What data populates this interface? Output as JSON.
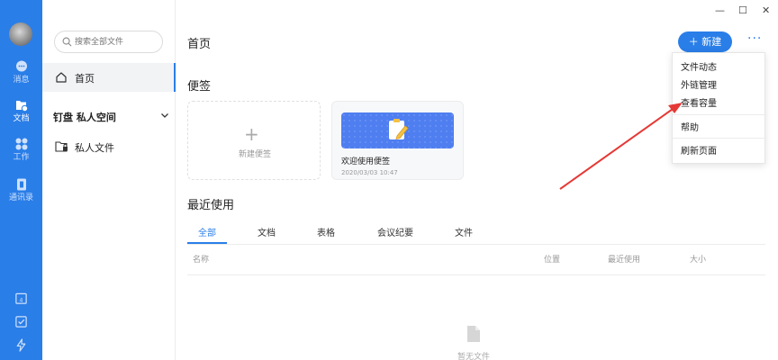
{
  "rail": {
    "items": [
      {
        "label": "消息",
        "icon": "chat-bubble-icon"
      },
      {
        "label": "文档",
        "icon": "cloud-folder-icon",
        "active": true
      },
      {
        "label": "工作",
        "icon": "grid-apps-icon"
      },
      {
        "label": "通讯录",
        "icon": "contacts-book-icon"
      }
    ],
    "bottom_icons": [
      "calendar-icon",
      "checkbox-icon",
      "lightning-icon"
    ]
  },
  "sidebar": {
    "search_placeholder": "搜索全部文件",
    "home_label": "首页",
    "space_label": "钉盘   私人空间",
    "private_label": "私人文件"
  },
  "window": {
    "minimize": "—",
    "maximize": "☐",
    "close": "✕"
  },
  "header": {
    "title": "首页",
    "new_label": "＋ 新建",
    "more_label": "···"
  },
  "notes": {
    "title": "便签",
    "new_label": "新建便签",
    "card": {
      "name": "欢迎使用便签",
      "date": "2020/03/03 10:47"
    }
  },
  "recent": {
    "title": "最近使用",
    "tabs": [
      "全部",
      "文档",
      "表格",
      "会议纪要",
      "文件"
    ],
    "columns": [
      "名称",
      "位置",
      "最近使用",
      "大小"
    ],
    "empty_text": "暂无文件"
  },
  "menu": {
    "items": [
      "文件动态",
      "外链管理",
      "查看容量",
      "帮助",
      "刷新页面"
    ]
  },
  "colors": {
    "accent": "#2a7ee8",
    "annotation_arrow": "#e53935"
  }
}
